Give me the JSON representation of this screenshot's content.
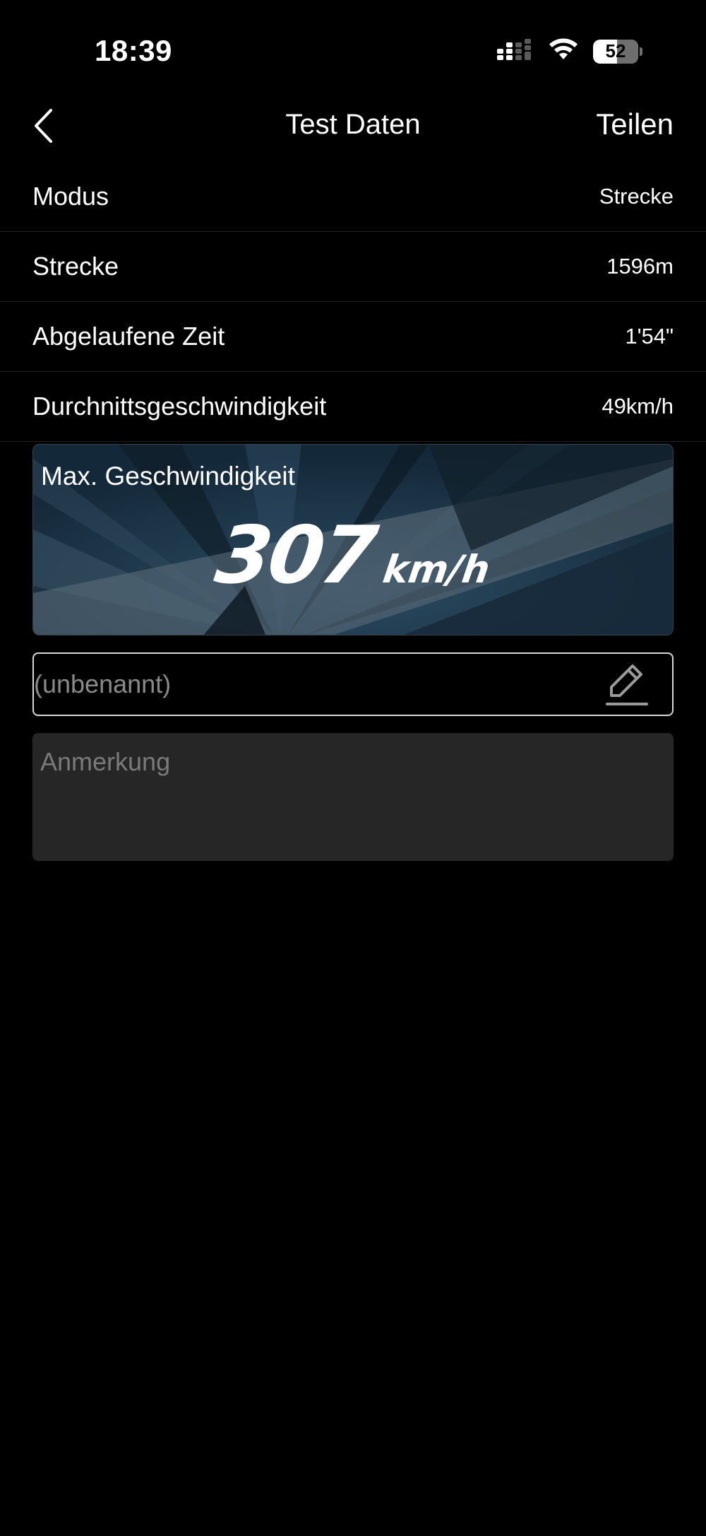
{
  "status_bar": {
    "time": "18:39",
    "battery_level": "52",
    "icons": [
      "cellular-signal-icon",
      "wifi-icon",
      "battery-icon"
    ]
  },
  "nav": {
    "title": "Test Daten",
    "share_label": "Teilen",
    "back_icon": "chevron-left-icon"
  },
  "rows": [
    {
      "label": "Modus",
      "value": "Strecke"
    },
    {
      "label": "Strecke",
      "value": "1596m"
    },
    {
      "label": "Abgelaufene Zeit",
      "value": "1'54\""
    },
    {
      "label": "Durchnittsgeschwindigkeit",
      "value": "49km/h"
    }
  ],
  "max_speed": {
    "label": "Max. Geschwindigkeit",
    "value": "307",
    "unit": "km/h"
  },
  "name_field": {
    "placeholder": "(unbenannt)",
    "value": "",
    "icon": "edit-pencil-icon"
  },
  "note_field": {
    "placeholder": "Anmerkung",
    "value": ""
  },
  "colors": {
    "background": "#000000",
    "text": "#ffffff",
    "card_base": "#1a3042",
    "note_bg": "#262626",
    "input_border": "#d8d8d8"
  }
}
